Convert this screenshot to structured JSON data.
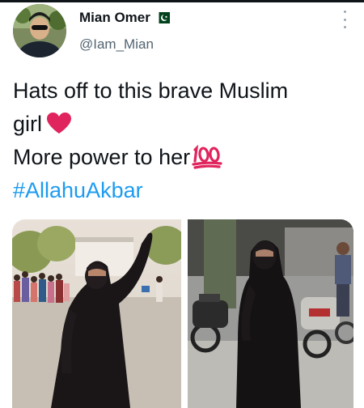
{
  "user": {
    "display_name": "Mian Omer",
    "handle": "@Iam_Mian",
    "flag_icon": "pakistan-flag-icon",
    "avatar_icon": "avatar"
  },
  "tweet": {
    "line1": "Hats off to this brave Muslim",
    "line2": "girl",
    "line3": "More power to her",
    "hashtag": "#AllahuAkbar",
    "emoji_heart": "red-heart-icon",
    "emoji_hundred": "hundred-points-icon"
  },
  "colors": {
    "text": "#0f1419",
    "secondary": "#536471",
    "link": "#1d9bf0",
    "heart": "#e0245e",
    "flag_green": "#01411c"
  },
  "media": {
    "photo_count": 2
  }
}
